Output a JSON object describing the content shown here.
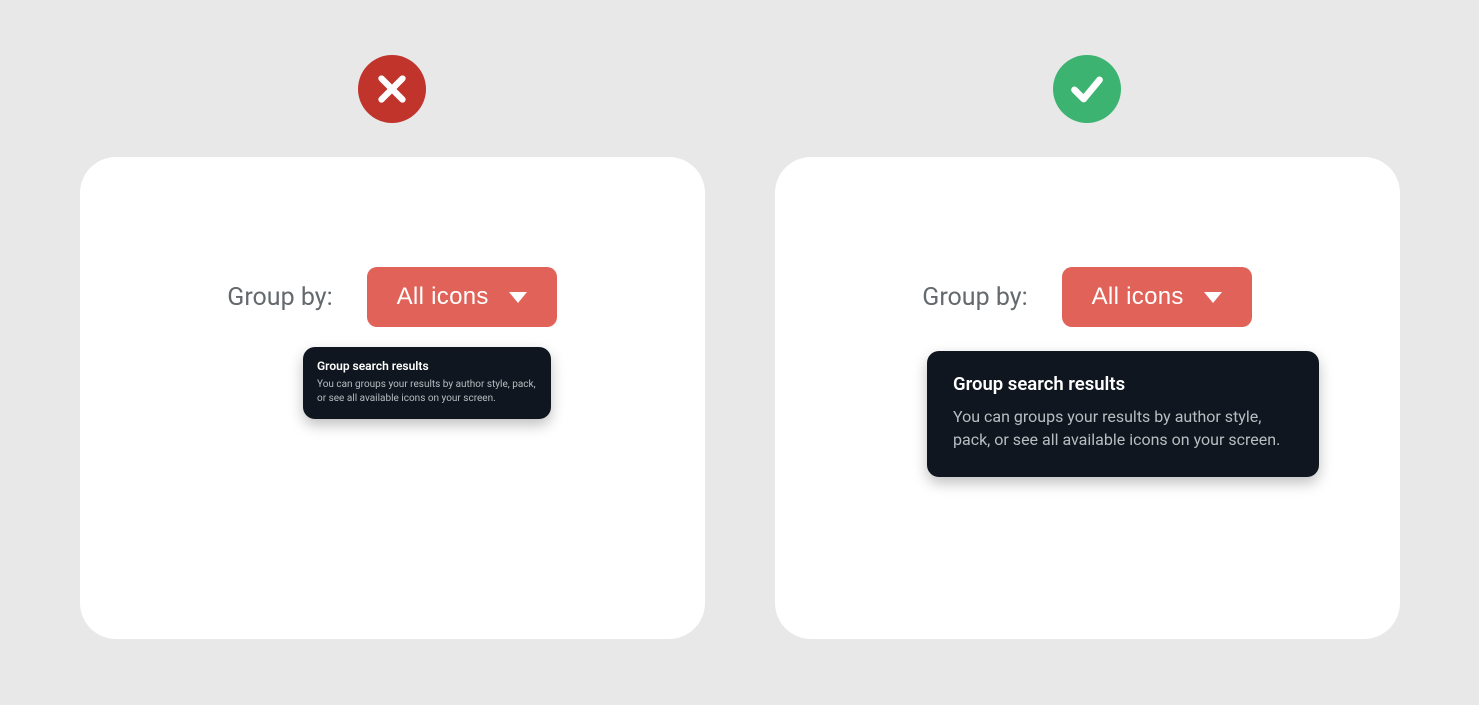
{
  "label": "Group by:",
  "dropdown_value": "All icons",
  "tooltip": {
    "title": "Group search results",
    "body": "You can groups your results by author style, pack, or see all available icons on your screen."
  },
  "status": {
    "bad_color": "#c0342b",
    "good_color": "#3cb371"
  }
}
